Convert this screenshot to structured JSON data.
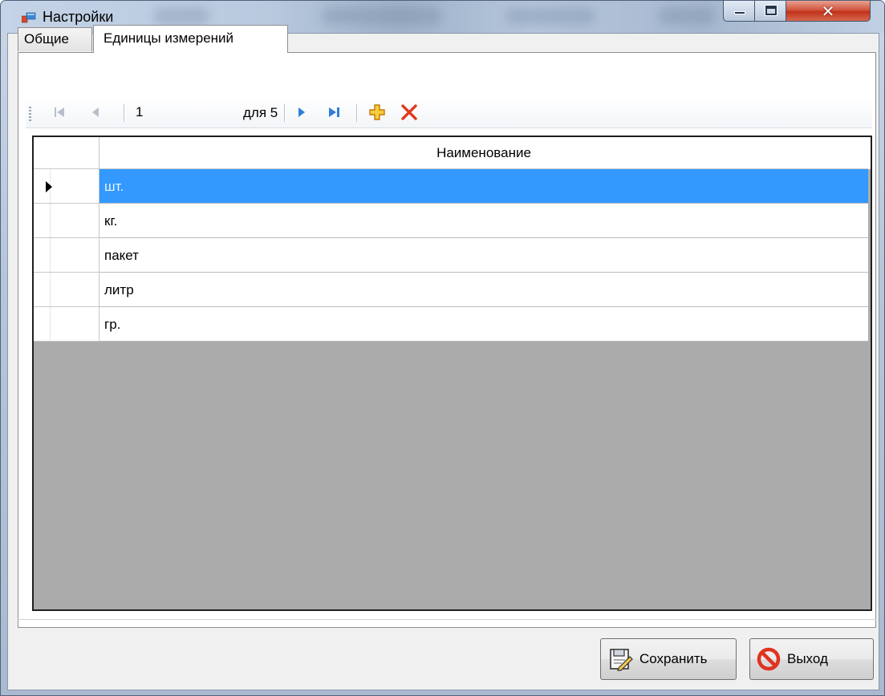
{
  "window": {
    "title": "Настройки"
  },
  "tabs": [
    {
      "label": "Общие",
      "active": false
    },
    {
      "label": "Единицы измерений",
      "active": true
    }
  ],
  "navigator": {
    "position": "1",
    "count_label": "для 5",
    "icons": [
      "move-first-icon",
      "move-previous-icon",
      "move-next-icon",
      "move-last-icon",
      "add-icon",
      "delete-icon"
    ]
  },
  "grid": {
    "column_header": "Наименование",
    "rows": [
      "шт.",
      "кг.",
      "пакет",
      "литр",
      "гр."
    ],
    "selected_index": 0
  },
  "buttons": {
    "save_label": "Сохранить",
    "exit_label": "Выход"
  },
  "colors": {
    "selection": "#3399ff",
    "close_button": "#c8442b",
    "add_icon": "#f2b51c",
    "delete_icon": "#e03a1c",
    "nav_icon": "#2f7fd8"
  }
}
